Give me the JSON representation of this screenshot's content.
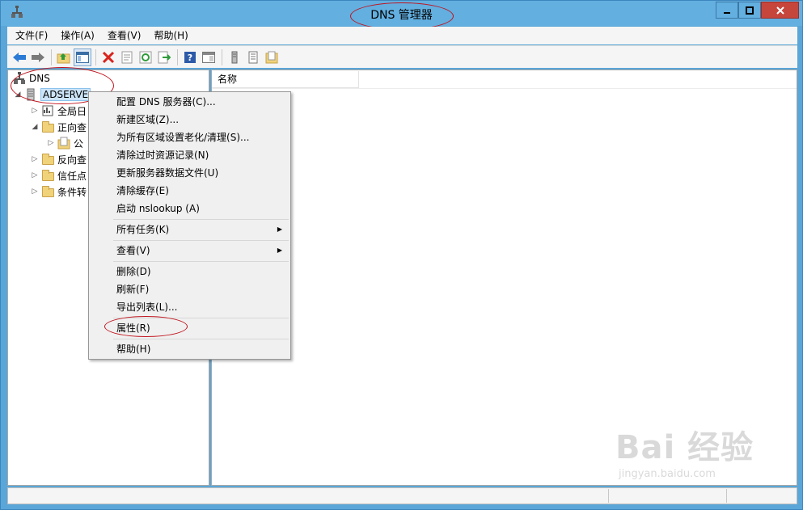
{
  "window": {
    "title": "DNS 管理器"
  },
  "menubar": [
    {
      "label": "文件(F)"
    },
    {
      "label": "操作(A)"
    },
    {
      "label": "查看(V)"
    },
    {
      "label": "帮助(H)"
    }
  ],
  "toolbar": {
    "icons": [
      "back-icon",
      "forward-icon",
      "up-folder-icon",
      "show-hide-tree-icon",
      "delete-icon",
      "properties-icon",
      "refresh-icon",
      "export-icon",
      "help-icon",
      "console-icon",
      "server-icon",
      "list-icon",
      "zone-icon"
    ]
  },
  "tree": {
    "root": "DNS",
    "server": "ADSERVE",
    "nodes": [
      {
        "label": "全局日"
      },
      {
        "label": "正向查"
      },
      {
        "label": "公"
      },
      {
        "label": "反向查"
      },
      {
        "label": "信任点"
      },
      {
        "label": "条件转"
      }
    ]
  },
  "list": {
    "column_name": "名称"
  },
  "context_menu": {
    "items": [
      "配置 DNS 服务器(C)...",
      "新建区域(Z)...",
      "为所有区域设置老化/清理(S)...",
      "清除过时资源记录(N)",
      "更新服务器数据文件(U)",
      "清除缓存(E)",
      "启动 nslookup (A)",
      "所有任务(K)",
      "查看(V)",
      "删除(D)",
      "刷新(F)",
      "导出列表(L)...",
      "属性(R)",
      "帮助(H)"
    ]
  },
  "watermark": {
    "brand": "Bai 经验",
    "url": "jingyan.baidu.com"
  },
  "colors": {
    "titlebar": "#62afe0",
    "close_button": "#c7463c",
    "annotation": "#c0141e"
  }
}
